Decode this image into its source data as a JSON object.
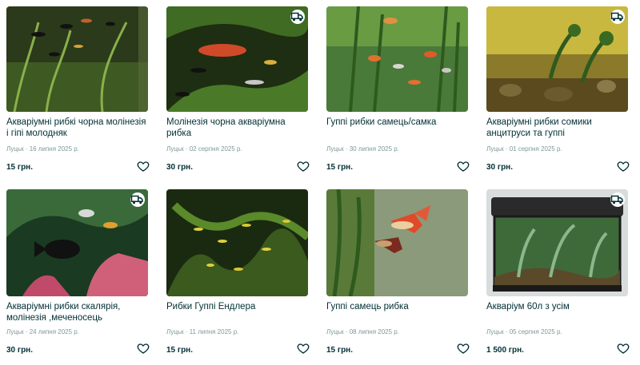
{
  "listings": [
    {
      "title": "Акваріумні рибкі чорна молінезія і гіпі молодняк",
      "meta": "Луцьк · 16 липня 2025 р.",
      "price": "15 грн.",
      "delivery": false,
      "photo_colors": [
        "#2b3a1a",
        "#5b7a2e",
        "#a8b84c"
      ]
    },
    {
      "title": "Молінезія чорна акваріумна рибка",
      "meta": "Луцьк · 02 серпня 2025 р.",
      "price": "30 грн.",
      "delivery": true,
      "photo_colors": [
        "#1e2e12",
        "#3f6b22",
        "#8fbf4a"
      ]
    },
    {
      "title": "Гуппі рибки самець/самка",
      "meta": "Луцьк · 30 липня 2025 р.",
      "price": "15 грн.",
      "delivery": false,
      "photo_colors": [
        "#3e6a2a",
        "#7fb04a",
        "#c9d87a"
      ]
    },
    {
      "title": "Акваріумні рибки сомики анцитруси та гуппі",
      "meta": "Луцьк · 01 серпня 2025 р.",
      "price": "30 грн.",
      "delivery": true,
      "photo_colors": [
        "#6a5a1e",
        "#a8962e",
        "#d8c85a"
      ]
    },
    {
      "title": "Акваріумні рибки скалярія, молінезія ,меченосець",
      "meta": "Луцьк · 24 липня 2025 р.",
      "price": "30 грн.",
      "delivery": true,
      "photo_colors": [
        "#1a3a22",
        "#4a8a4e",
        "#d0607a"
      ]
    },
    {
      "title": "Рибки Гуппі Ендлера",
      "meta": "Луцьк · 11 липня 2025 р.",
      "price": "15 грн.",
      "delivery": false,
      "photo_colors": [
        "#1a2a10",
        "#3a5a1e",
        "#c8c83a"
      ]
    },
    {
      "title": "Гуппі самець рибка",
      "meta": "Луцьк · 08 липня 2025 р.",
      "price": "15 грн.",
      "delivery": false,
      "photo_colors": [
        "#6a7a5a",
        "#a8b890",
        "#e05a3a"
      ]
    },
    {
      "title": "Акваріум 60л з усім",
      "meta": "Луцьк · 05 серпня 2025 р.",
      "price": "1 500 грн.",
      "delivery": true,
      "photo_colors": [
        "#2a2a2a",
        "#3e6a3a",
        "#8ab88a"
      ]
    }
  ],
  "icons": {
    "heart": "heart-icon",
    "delivery": "delivery-truck-icon"
  }
}
